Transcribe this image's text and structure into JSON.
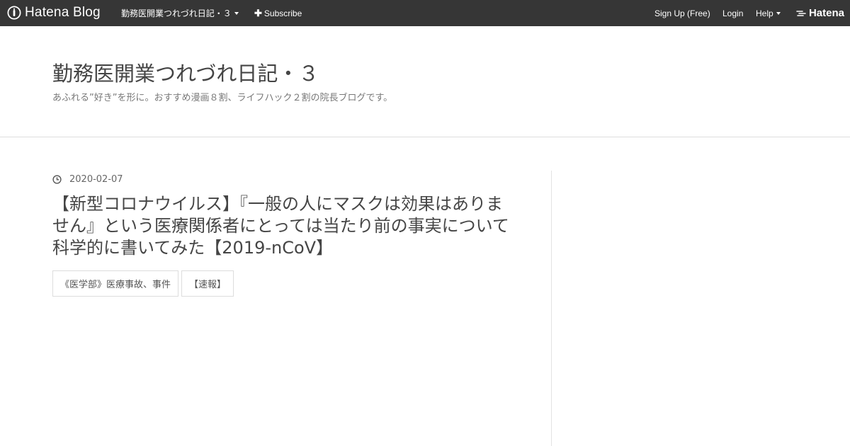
{
  "topbar": {
    "brand_text": "Hatena Blog",
    "blog_menu_label": "勤務医開業つれづれ日記・３",
    "subscribe_label": "Subscribe",
    "signup_label": "Sign Up (Free)",
    "login_label": "Login",
    "help_label": "Help",
    "hatena_logo_text": "Hatena"
  },
  "header": {
    "title": "勤務医開業つれづれ日記・３",
    "description": "あふれる”好き”を形に。おすすめ漫画８割、ライフハック２割の院長ブログです。"
  },
  "entry": {
    "date": "2020-02-07",
    "title": "【新型コロナウイルス】『一般の人にマスクは効果はありません』という医療関係者にとっては当たり前の事実について科学的に書いてみた【2019-nCoV】",
    "tags": [
      "《医学部》医療事故、事件",
      "【速報】"
    ]
  },
  "icons": {
    "brand": "hatena-blog-logo-icon",
    "date": "clock-icon",
    "subscribe": "plus-icon"
  },
  "colors": {
    "topbar_bg": "#363636",
    "text": "#454545",
    "border": "#dddddd"
  }
}
